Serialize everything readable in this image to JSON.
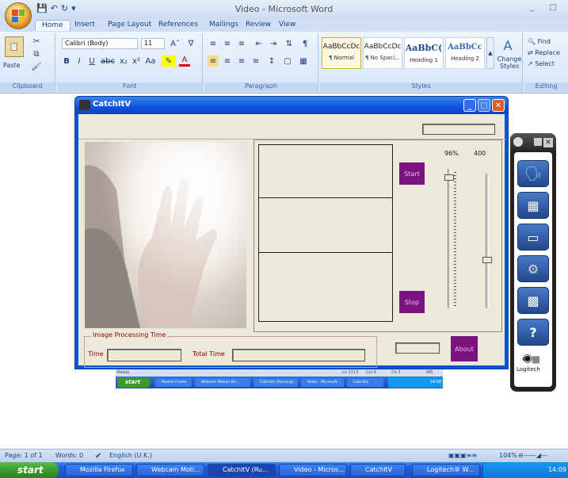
{
  "word": {
    "window_title": "Video - Microsoft Word",
    "tabs": [
      "Home",
      "Insert",
      "Page Layout",
      "References",
      "Mailings",
      "Review",
      "View"
    ],
    "font_name": "Calibri (Body)",
    "font_size": "11",
    "paste_label": "Paste",
    "groups": [
      "Clipboard",
      "Font",
      "Paragraph",
      "Styles",
      "Editing"
    ],
    "styles": [
      {
        "sample": "AaBbCcDc",
        "name": "¶ Normal"
      },
      {
        "sample": "AaBbCcDc",
        "name": "¶ No Spaci..."
      },
      {
        "sample": "AaBbC(",
        "name": "Heading 1"
      },
      {
        "sample": "AaBbCc",
        "name": "Heading 2"
      }
    ],
    "change_styles": "Change Styles",
    "editing": {
      "find": "Find",
      "replace": "Replace",
      "select": "Select"
    }
  },
  "catchitv": {
    "title": "CatchItV",
    "percent": "96%",
    "value": "400",
    "start_label": "Start",
    "stop_label": "Stop",
    "about_label": "About",
    "group_label": "Image Processing Time",
    "time_label": "Time",
    "total_time_label": "Total Time",
    "slider_left_level": 0.04,
    "slider_right_level": 0.6
  },
  "mini_screenshot": {
    "status": [
      "Ready",
      "Ln 1213",
      "Col 9",
      "Ch 3",
      "INS"
    ],
    "start": "start",
    "tasks": [
      "Mozilla Firefox",
      "Webcam Motion De...",
      "CatchItV (Running)...",
      "Video - Microsoft ...",
      "CatchItV"
    ],
    "clock": "14:09"
  },
  "logitech": {
    "brand": "Logitech"
  },
  "status_bar": {
    "page": "Page: 1 of 1",
    "words": "Words: 0",
    "language": "English (U.K.)",
    "zoom": "104%"
  },
  "taskbar": {
    "start": "start",
    "tasks": [
      "Mozilla Firefox",
      "Webcam Moti...",
      "CatchItV (Ru...",
      "Video - Micros...",
      "CatchItV",
      "Logitech® W..."
    ],
    "clock": "14:09"
  }
}
